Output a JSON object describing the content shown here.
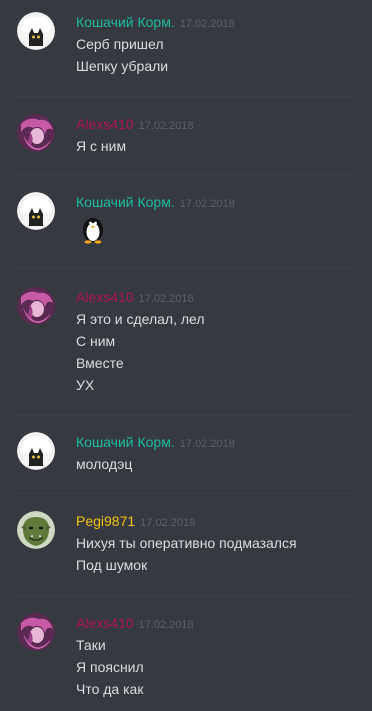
{
  "colors": {
    "background": "#36393f",
    "kot": "#1abc9c",
    "alexs": "#ad1457",
    "pegi": "#f1c40f",
    "text": "#dcddde",
    "timestamp": "#5d6067"
  },
  "messages": [
    {
      "author": "Кошачий Корм.",
      "time": "17.02.2018",
      "avatar": "cat-avatar",
      "lines": [
        "Серб пришел",
        "Шепку убрали"
      ]
    },
    {
      "author": "Alexs410",
      "time": "17.02.2018",
      "avatar": "anime-avatar",
      "lines": [
        "Я с ним"
      ]
    },
    {
      "author": "Кошачий Корм.",
      "time": "17.02.2018",
      "avatar": "cat-avatar",
      "emoji": "penguin-emoji",
      "lines": []
    },
    {
      "author": "Alexs410",
      "time": "17.02.2018",
      "avatar": "anime-avatar",
      "lines": [
        "Я это и сделал, лел",
        "С ним",
        "Вместе",
        "УХ"
      ]
    },
    {
      "author": "Кошачий Корм.",
      "time": "17.02.2018",
      "avatar": "cat-avatar",
      "lines": [
        "молодэц"
      ]
    },
    {
      "author": "Pegi9871",
      "time": "17.02.2018",
      "avatar": "orc-avatar",
      "lines": [
        "Нихуя ты оперативно подмазался",
        "Под шумок"
      ]
    },
    {
      "author": "Alexs410",
      "time": "17.02.2018",
      "avatar": "anime-avatar",
      "lines": [
        "Таки",
        "Я пояснил",
        "Что да как"
      ]
    }
  ]
}
